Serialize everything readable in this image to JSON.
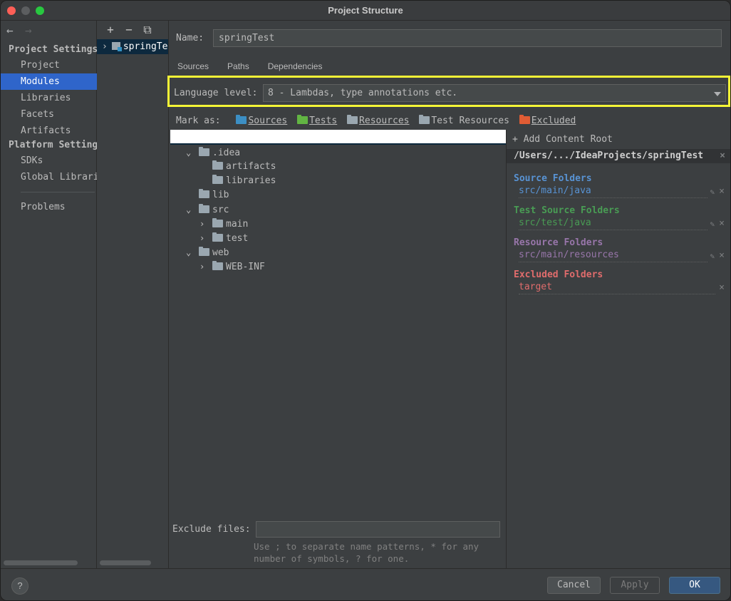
{
  "window": {
    "title": "Project Structure"
  },
  "leftnav": {
    "back_icon": "←",
    "forward_icon": "→",
    "project_settings_header": "Project Settings",
    "project_items": [
      "Project",
      "Modules",
      "Libraries",
      "Facets",
      "Artifacts"
    ],
    "selected": "Modules",
    "platform_settings_header": "Platform Settings",
    "platform_items": [
      "SDKs",
      "Global Libraries"
    ],
    "other_items": [
      "Problems"
    ]
  },
  "modules": {
    "toolbar": {
      "add": "+",
      "remove": "−",
      "copy": "⧉"
    },
    "items": [
      {
        "label": "springTest"
      }
    ]
  },
  "main": {
    "name_label": "Name:",
    "name_value": "springTest",
    "tabs": [
      "Sources",
      "Paths",
      "Dependencies"
    ],
    "active_tab": "Sources",
    "language_level_label": "Language level:",
    "language_level_value": "8 - Lambdas, type annotations etc.",
    "mark_as": {
      "label": "Mark as:",
      "sources": "Sources",
      "tests": "Tests",
      "resources": "Resources",
      "test_resources": "Test Resources",
      "excluded": "Excluded"
    },
    "tree": [
      {
        "label": ".idea",
        "expanded": true
      },
      {
        "label": "artifacts"
      },
      {
        "label": "libraries"
      },
      {
        "label": "lib"
      },
      {
        "label": "src",
        "expanded": true
      },
      {
        "label": "main",
        "expanded": false
      },
      {
        "label": "test",
        "expanded": false
      },
      {
        "label": "web",
        "expanded": true
      },
      {
        "label": "WEB-INF",
        "expanded": false
      }
    ],
    "exclude_files_label": "Exclude files:",
    "exclude_files_value": "",
    "exclude_hint": "Use ; to separate name patterns, * for any number of symbols, ? for one."
  },
  "roots": {
    "add_content_root": "Add Content Root",
    "root_path": "/Users/.../IdeaProjects/springTest",
    "source_folders_title": "Source Folders",
    "source_folder": "src/main/java",
    "test_source_folders_title": "Test Source Folders",
    "test_source_folder": "src/test/java",
    "resource_folders_title": "Resource Folders",
    "resource_folder": "src/main/resources",
    "excluded_folders_title": "Excluded Folders",
    "excluded_folder": "target",
    "colors": {
      "source": "#5893d4",
      "test": "#499c54",
      "resource": "#9876aa",
      "excluded": "#e06c6c"
    }
  },
  "buttons": {
    "help": "?",
    "cancel": "Cancel",
    "apply": "Apply",
    "ok": "OK"
  },
  "colors": {
    "selection": "#2f65ca",
    "highlight": "#f5f536",
    "ok_button": "#365880"
  }
}
